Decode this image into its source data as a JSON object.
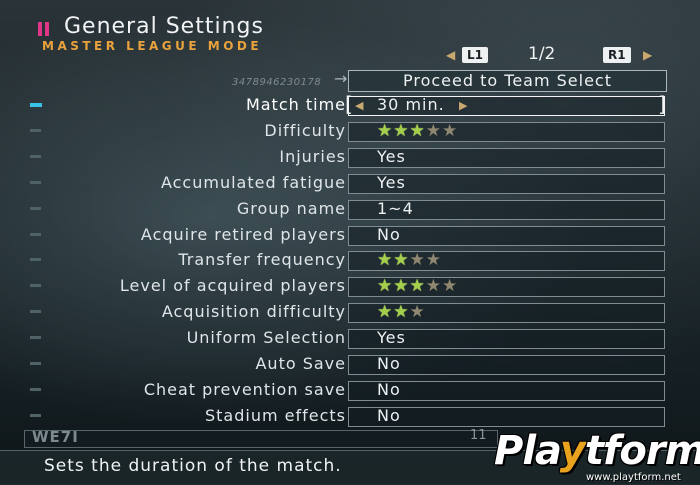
{
  "header": {
    "title": "General Settings",
    "subtitle": "MASTER LEAGUE MODE",
    "page_left_button": "L1",
    "page_indicator": "1/2",
    "page_right_button": "R1"
  },
  "code": "3478946230178",
  "proceed_label": "Proceed to Team Select",
  "rows": [
    {
      "label": "Match time",
      "value": "30 min.",
      "stars_on": null,
      "stars_total": null
    },
    {
      "label": "Difficulty",
      "value": "",
      "stars_on": 3,
      "stars_total": 5
    },
    {
      "label": "Injuries",
      "value": "Yes",
      "stars_on": null,
      "stars_total": null
    },
    {
      "label": "Accumulated fatigue",
      "value": "Yes",
      "stars_on": null,
      "stars_total": null
    },
    {
      "label": "Group name",
      "value": "1~4",
      "stars_on": null,
      "stars_total": null
    },
    {
      "label": "Acquire retired players",
      "value": "No",
      "stars_on": null,
      "stars_total": null
    },
    {
      "label": "Transfer frequency",
      "value": "",
      "stars_on": 2,
      "stars_total": 4
    },
    {
      "label": "Level of acquired players",
      "value": "",
      "stars_on": 3,
      "stars_total": 5
    },
    {
      "label": "Acquisition difficulty",
      "value": "",
      "stars_on": 2,
      "stars_total": 3
    },
    {
      "label": "Uniform Selection",
      "value": "Yes",
      "stars_on": null,
      "stars_total": null
    },
    {
      "label": "Auto Save",
      "value": "No",
      "stars_on": null,
      "stars_total": null
    },
    {
      "label": "Cheat prevention save",
      "value": "No",
      "stars_on": null,
      "stars_total": null
    },
    {
      "label": "Stadium effects",
      "value": "No",
      "stars_on": null,
      "stars_total": null
    }
  ],
  "active_row": 0,
  "bottom": {
    "game_logo": "WE7I",
    "number": "11"
  },
  "help_text": "Sets the duration of the match.",
  "watermark": {
    "brand_prefix": "Pla",
    "brand_y": "y",
    "brand_suffix": "tform",
    "url": "www.playtform.net"
  },
  "colors": {
    "accent_pink": "#e0368a",
    "subtitle_orange": "#e9a23c",
    "active_marker": "#38c2e6",
    "star_on": "#a3cf4a",
    "star_off": "#8f8770"
  }
}
